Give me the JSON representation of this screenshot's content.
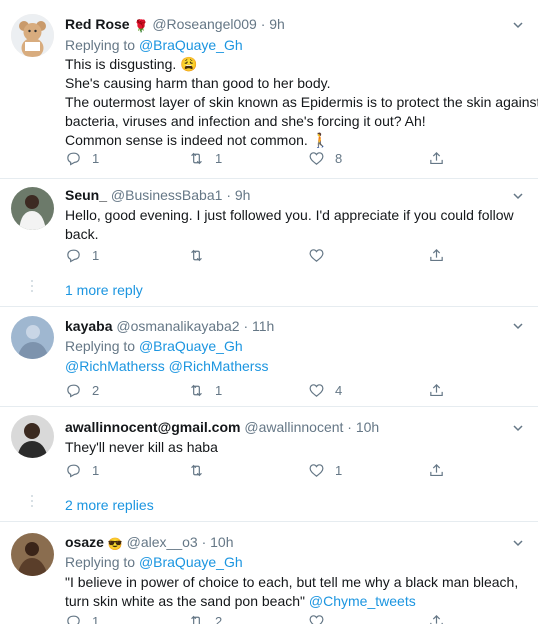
{
  "tweets": [
    {
      "name": "Red Rose",
      "name_glyph": "🌹",
      "handle": "@Roseangel009",
      "time": "· 9h",
      "replying_prefix": "Replying to",
      "replying_to": "@BraQuaye_Gh",
      "lines": [
        "This is disgusting. 😩",
        "She's causing harm than good to her body.",
        "The outermost layer of skin known as Epidermis is to protect the skin against",
        "bacteria, viruses and infection and she's forcing it out? Ah!",
        "Common sense is indeed not common. 🚶"
      ],
      "replies": "1",
      "retweets": "1",
      "likes": "8"
    },
    {
      "name": "Seun_",
      "handle": "@BusinessBaba1",
      "time": "· 9h",
      "lines": [
        "Hello, good evening. I just followed you. I'd appreciate if you could follow",
        "back."
      ],
      "replies": "1",
      "retweets": "",
      "likes": ""
    },
    {
      "name": "kayaba",
      "handle": "@osmanalikayaba2",
      "time": "· 11h",
      "replying_prefix": "Replying to",
      "replying_to": "@BraQuaye_Gh",
      "mentions": "@RichMatherss @RichMatherss",
      "replies": "2",
      "retweets": "1",
      "likes": "4"
    },
    {
      "name": "awallinnocent@gmail.com",
      "handle": "@awallinnocent",
      "time": "· 10h",
      "lines": [
        "They'll never kill as haba"
      ],
      "replies": "1",
      "retweets": "",
      "likes": "1"
    },
    {
      "name": "osaze",
      "name_glyph": "😎",
      "handle": "@alex__o3",
      "time": "· 10h",
      "replying_prefix": "Replying to",
      "replying_to": "@BraQuaye_Gh",
      "lines": [
        "\"I believe in power of choice to each, but tell me why a black man bleach,",
        "turn skin white as the sand pon beach\""
      ],
      "mention_tail": "@Chyme_tweets",
      "replies": "1",
      "retweets": "2",
      "likes": ""
    }
  ],
  "more_replies": [
    "1 more reply",
    "2 more replies"
  ],
  "colors": {
    "link": "#1b95e0",
    "muted": "#657786",
    "divider": "#e6ecf0"
  }
}
